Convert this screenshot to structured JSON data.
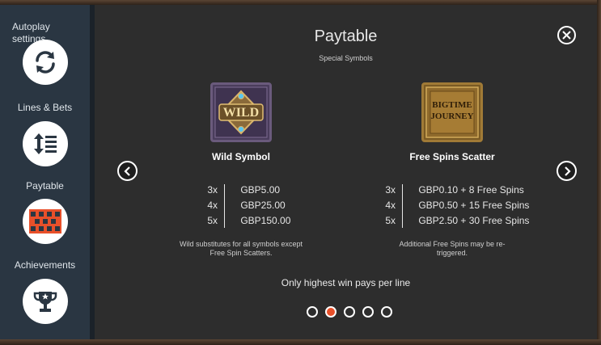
{
  "sidebar": {
    "items": [
      {
        "label": "Autoplay settings",
        "icon": "refresh-icon"
      },
      {
        "label": "Lines & Bets",
        "icon": "lines-bets-icon"
      },
      {
        "label": "Paytable",
        "icon": "paytable-grid-icon"
      },
      {
        "label": "Achievements",
        "icon": "trophy-icon"
      }
    ],
    "active_index": 2
  },
  "panel": {
    "title": "Paytable",
    "subtitle": "Special Symbols",
    "footer_note": "Only highest win pays per line"
  },
  "symbols": [
    {
      "image_text": "WILD",
      "name": "Wild Symbol",
      "pays": [
        {
          "mult": "3x",
          "value": "GBP5.00"
        },
        {
          "mult": "4x",
          "value": "GBP25.00"
        },
        {
          "mult": "5x",
          "value": "GBP150.00"
        }
      ],
      "note_line1": "Wild substitutes for all symbols except",
      "note_line2": "Free Spin Scatters."
    },
    {
      "image_text_line1": "BIGTIME",
      "image_text_line2": "JOURNEY",
      "name": "Free Spins Scatter",
      "pays": [
        {
          "mult": "3x",
          "value": "GBP0.10 + 8 Free Spins"
        },
        {
          "mult": "4x",
          "value": "GBP0.50 + 15 Free Spins"
        },
        {
          "mult": "5x",
          "value": "GBP2.50 + 30 Free Spins"
        }
      ],
      "note_line1": "Additional Free Spins may be re-",
      "note_line2": "triggered."
    }
  ],
  "pagination": {
    "total": 5,
    "current": 2
  },
  "colors": {
    "accent": "#e8502a",
    "sidebar_bg": "#2a3642",
    "panel_bg": "#2d2d2d"
  }
}
